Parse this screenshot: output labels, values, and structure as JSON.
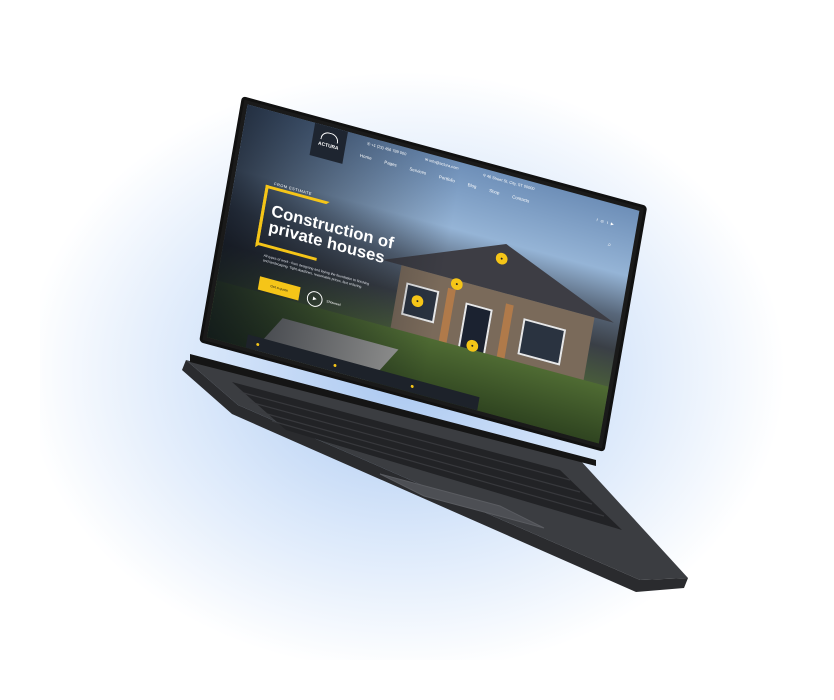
{
  "site": {
    "logo": "ACTURA",
    "contact": [
      {
        "icon": "phone-icon",
        "text": "+1 (23) 456 789 000"
      },
      {
        "icon": "mail-icon",
        "text": "info@actura.com"
      },
      {
        "icon": "pin-icon",
        "text": "46 Street St, City, ST 00000"
      }
    ],
    "nav": [
      "Home",
      "Pages",
      "Services",
      "Portfolio",
      "Blog",
      "Shop",
      "Contacts"
    ],
    "social_icons": [
      "facebook-icon",
      "instagram-icon",
      "twitter-icon",
      "youtube-icon"
    ],
    "hero": {
      "eyebrow": "FROM ESTIMATE",
      "title": "Construction of private houses",
      "description": "All types of work - from designing and laying the foundation to finishing and landscaping. Tight deadlines, reasonable prices, fast ordering.",
      "cta_label": "Get a quote",
      "showreel_label": "Showreel"
    }
  },
  "colors": {
    "accent": "#f5c518",
    "dark": "#1e2530"
  }
}
